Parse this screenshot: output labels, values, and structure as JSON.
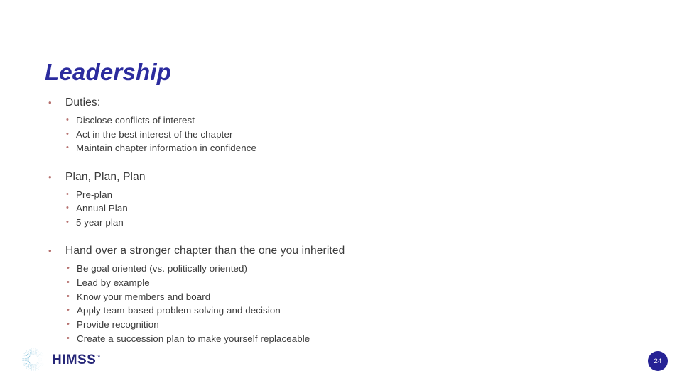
{
  "slide": {
    "title": "Leadership",
    "title_color": "#2b2b9e",
    "background_color": "#ffffff",
    "body_text_color": "#3a3a3a",
    "bullet_color": "#b5706e",
    "sections": [
      {
        "heading": "Duties:",
        "items": [
          "Disclose conflicts of interest",
          "Act in the best interest of the chapter",
          "Maintain chapter information in confidence"
        ]
      },
      {
        "heading": "Plan, Plan, Plan",
        "items": [
          "Pre-plan",
          "Annual Plan",
          "5 year plan"
        ]
      },
      {
        "heading": "Hand over a stronger chapter than the one you inherited",
        "items": [
          "Be goal oriented (vs. politically oriented)",
          "Lead by example",
          "Know your members and board",
          "Apply team-based problem solving and decision",
          "Provide recognition",
          "Create a succession plan to make yourself replaceable"
        ]
      }
    ]
  },
  "footer": {
    "logo_text": "HIMSS",
    "logo_trademark": "™",
    "logo_color": "#262678",
    "page_number": "24",
    "page_badge_color": "#262295"
  },
  "bullet_glyphs": {
    "level1": "•",
    "level2": "•"
  }
}
